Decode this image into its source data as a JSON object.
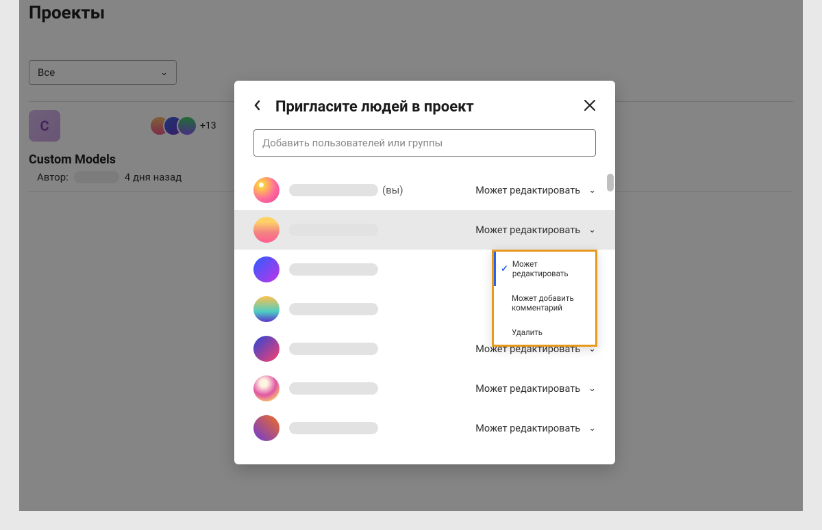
{
  "page": {
    "title": "Проекты",
    "filter": "Все"
  },
  "project": {
    "thumb_letter": "С",
    "extra_avatars": "+13",
    "name": "Custom Models",
    "author_label": "Автор:",
    "timestamp": "4 дня назад"
  },
  "modal": {
    "title": "Пригласите людей в проект",
    "search_placeholder": "Добавить пользователей или группы",
    "you_suffix": "(вы)",
    "permission_label": "Может редактировать",
    "dropdown": {
      "edit": "Может редактировать",
      "comment": "Может добавить комментарий",
      "delete": "Удалить"
    }
  }
}
